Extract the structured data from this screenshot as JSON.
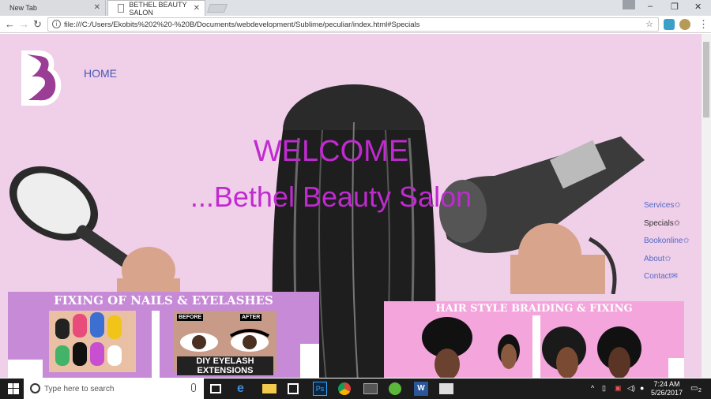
{
  "browser": {
    "tabs": [
      {
        "label": "New Tab"
      },
      {
        "label": "BETHEL BEAUTY SALON"
      }
    ],
    "address": "file:///C:/Users/Ekobits%202%20-%20B/Documents/webdevelopment/Sublime/peculiar/index.html#Specials"
  },
  "page": {
    "nav_home": "HOME",
    "welcome_line1": "WELCOME",
    "welcome_line2": "...Bethel Beauty Salon",
    "side_nav": [
      {
        "label": "Services✩"
      },
      {
        "label": "Specials✩"
      },
      {
        "label": "Bookonline✩"
      },
      {
        "label": "About✩"
      },
      {
        "label": "Contact✉"
      }
    ],
    "panel_left_title": "FIXING OF NAILS & EYELASHES",
    "panel_right_title": "HAIR STYLE BRAIDING & FIXING",
    "lash_before": "BEFORE",
    "lash_after": "AFTER",
    "lash_caption": "DIY EYELASH EXTENSIONS"
  },
  "taskbar": {
    "search_placeholder": "Type here to search",
    "time": "7:24 AM",
    "date": "5/26/2017",
    "notifications": "2"
  },
  "colors": {
    "page_bg": "#f0cfe9",
    "welcome": "#c02ad0",
    "nav_link": "#4a58b5",
    "panel_left": "#c68ad6",
    "panel_right": "#f4a6dc"
  }
}
